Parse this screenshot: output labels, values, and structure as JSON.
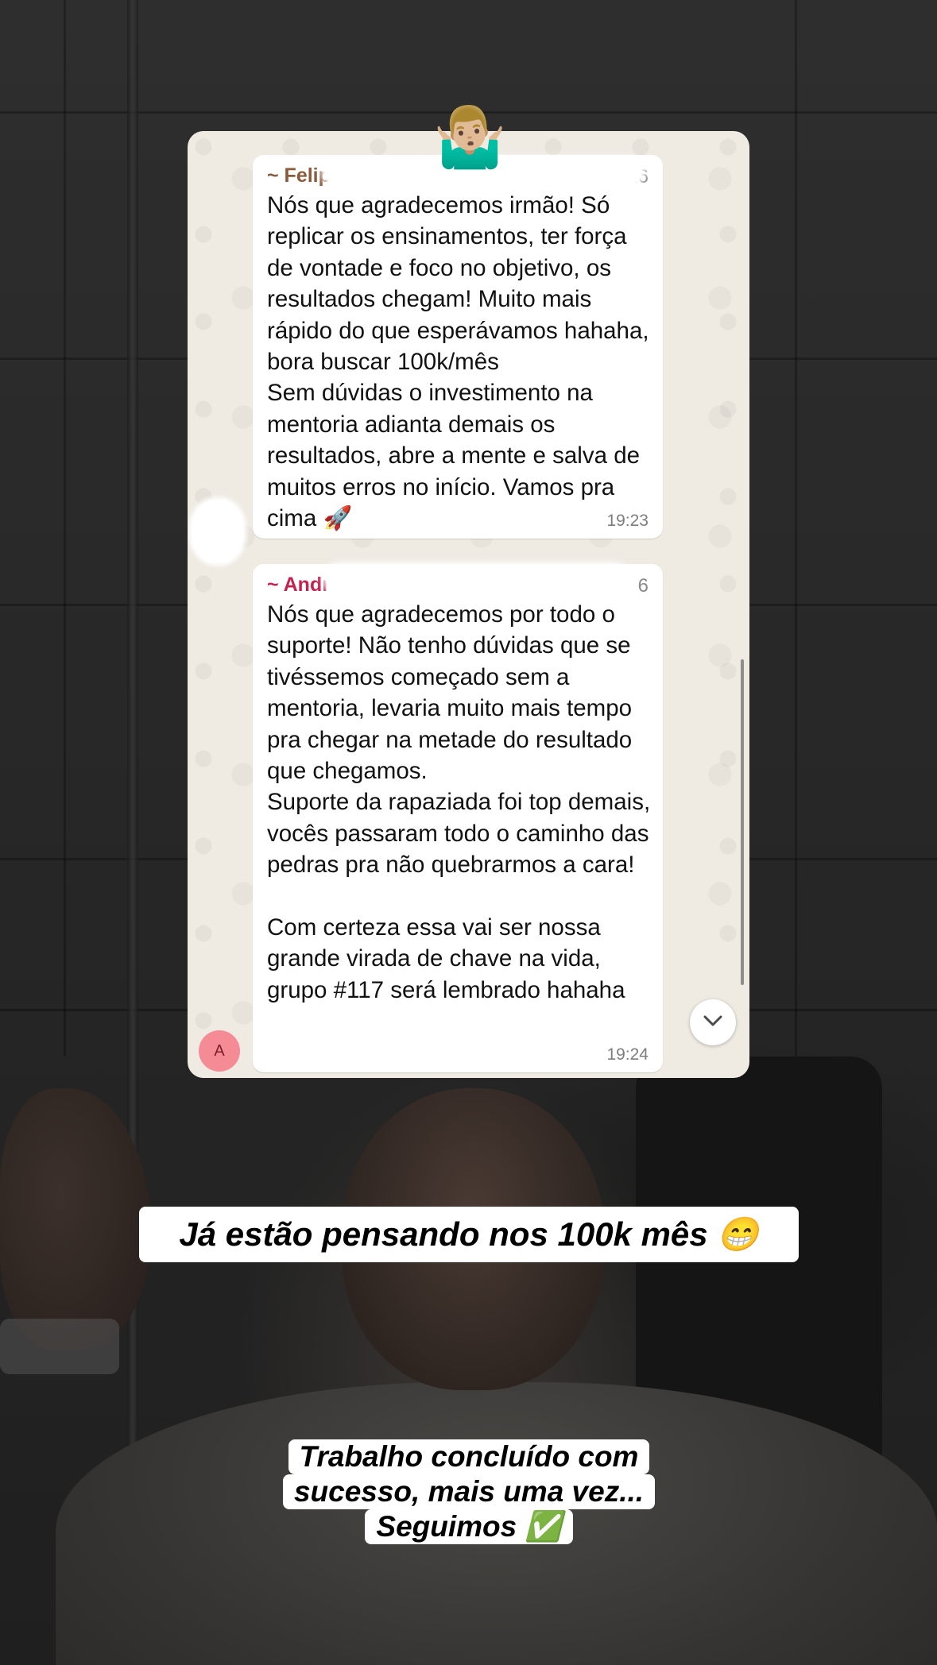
{
  "chat": {
    "messages": [
      {
        "sender": "~ Felip",
        "phone_suffix": "26",
        "text": "Nós que agradecemos irmão! Só replicar os ensinamentos, ter força de vontade e foco no objetivo, os resultados chegam! Muito mais rápido do que esperávamos hahaha, bora buscar 100k/mês\nSem dúvidas o investimento na mentoria adianta demais os resultados, abre a mente e salva de muitos erros no início. Vamos pra cima 🚀",
        "time": "19:23"
      },
      {
        "sender": "~ Andr",
        "phone_suffix": "6",
        "text": "Nós que agradecemos por todo o suporte! Não tenho dúvidas que se tivéssemos começado sem a mentoria, levaria muito mais tempo pra chegar na metade do resultado que chegamos.\nSuporte da rapaziada foi top demais, vocês passaram todo o caminho das pedras pra não quebrarmos a cara!\n\nCom certeza essa vai ser nossa grande virada de chave na vida, grupo #117 será lembrado hahaha",
        "time": "19:24"
      }
    ],
    "avatar_letter": "A",
    "scroll_icon": "chevron-down-icon"
  },
  "sticker": {
    "emoji": "🤷🏼‍♂️"
  },
  "captions": {
    "first": "Já estão pensando nos 100k mês 😁",
    "second_lines": [
      "Trabalho concluído com",
      "sucesso, mais uma vez...",
      "Seguimos ✅"
    ]
  },
  "colors": {
    "chat_background": "#efeae2",
    "bubble": "#ffffff",
    "sender1": "#8a5a3b",
    "sender2": "#c4234f",
    "avatar": "#f48b95"
  }
}
